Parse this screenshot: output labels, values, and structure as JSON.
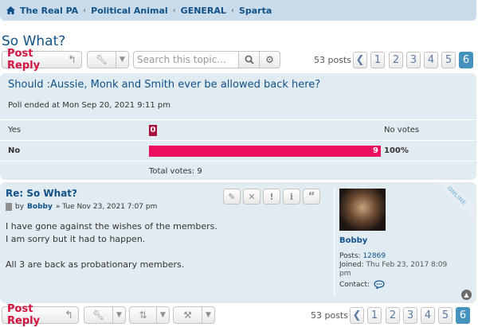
{
  "breadcrumb": {
    "items": [
      "The Real PA",
      "Political Animal",
      "GENERAL",
      "Sparta"
    ]
  },
  "topic": {
    "title": "So What?"
  },
  "action_bar_top": {
    "post_reply_label": "Post Reply",
    "search_placeholder": "Search this topic...",
    "posts_count": "53 posts",
    "pages": [
      "1",
      "2",
      "3",
      "4",
      "5",
      "6"
    ],
    "active_page": "6"
  },
  "poll": {
    "question": "Should :Aussie, Monk and Smith ever be allowed back here?",
    "ended": "Poll ended at Mon Sep 20, 2021 9:11 pm",
    "options": [
      {
        "label": "Yes",
        "votes": "0",
        "result": "No votes",
        "fraction": 0
      },
      {
        "label": "No",
        "votes": "9",
        "result": "100%",
        "fraction": 1
      }
    ],
    "total": "Total votes: 9"
  },
  "post": {
    "title": "Re: So What?",
    "by": "by",
    "author": "Bobby",
    "date": "» Tue Nov 23, 2021 7:07 pm",
    "body": [
      "I have gone against the wishes of the members.",
      "I am sorry but it had to happen.",
      "",
      "All 3 are back as probationary members."
    ],
    "profile": {
      "username": "Bobby",
      "posts_label": "Posts:",
      "posts_value": "12869",
      "joined_label": "Joined:",
      "joined_value": "Thu Feb 23, 2017 8:09 pm",
      "contact_label": "Contact:",
      "online_label": "ONLINE"
    }
  },
  "action_bar_bottom": {
    "post_reply_label": "Post Reply",
    "posts_count": "53 posts",
    "pages": [
      "1",
      "2",
      "3",
      "4",
      "5",
      "6"
    ],
    "active_page": "6"
  },
  "colors": {
    "accent": "#105289",
    "reply": "#d31141",
    "bar": "#eb0e5f",
    "panel": "#e1ebf2"
  }
}
